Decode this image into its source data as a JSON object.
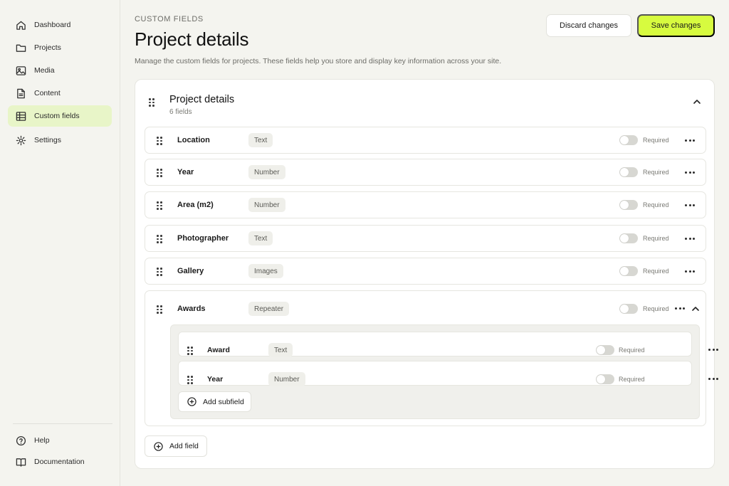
{
  "sidebar": {
    "items": [
      {
        "label": "Dashboard",
        "icon": "home-icon"
      },
      {
        "label": "Projects",
        "icon": "folder-icon"
      },
      {
        "label": "Media",
        "icon": "image-icon"
      },
      {
        "label": "Content",
        "icon": "document-icon"
      },
      {
        "label": "Custom fields",
        "icon": "table-icon",
        "active": true
      },
      {
        "label": "Settings",
        "icon": "gear-icon"
      }
    ],
    "footer": [
      {
        "label": "Help",
        "icon": "help-icon"
      },
      {
        "label": "Documentation",
        "icon": "book-icon"
      }
    ]
  },
  "header": {
    "eyebrow": "CUSTOM FIELDS",
    "title": "Project details",
    "subtitle": "Manage the custom fields for projects. These fields help you store and display key information across your site.",
    "discard_label": "Discard changes",
    "save_label": "Save changes"
  },
  "group": {
    "title": "Project details",
    "count": "6 fields",
    "fields": [
      {
        "name": "Location",
        "type": "Text",
        "required_label": "Required",
        "required": false
      },
      {
        "name": "Year",
        "type": "Number",
        "required_label": "Required",
        "required": false
      },
      {
        "name": "Area (m2)",
        "type": "Number",
        "required_label": "Required",
        "required": false
      },
      {
        "name": "Photographer",
        "type": "Text",
        "required_label": "Required",
        "required": false
      },
      {
        "name": "Gallery",
        "type": "Images",
        "required_label": "Required",
        "required": false
      },
      {
        "name": "Awards",
        "type": "Repeater",
        "required_label": "Required",
        "required": false
      }
    ],
    "subfields": [
      {
        "name": "Award",
        "type": "Text",
        "required_label": "Required",
        "required": false
      },
      {
        "name": "Year",
        "type": "Number",
        "required_label": "Required",
        "required": false
      }
    ],
    "add_subfield_label": "Add subfield",
    "add_field_label": "Add field"
  },
  "colors": {
    "accent": "#d7fb3f",
    "active_nav": "#e8f5c8",
    "background": "#f4f4ef"
  }
}
